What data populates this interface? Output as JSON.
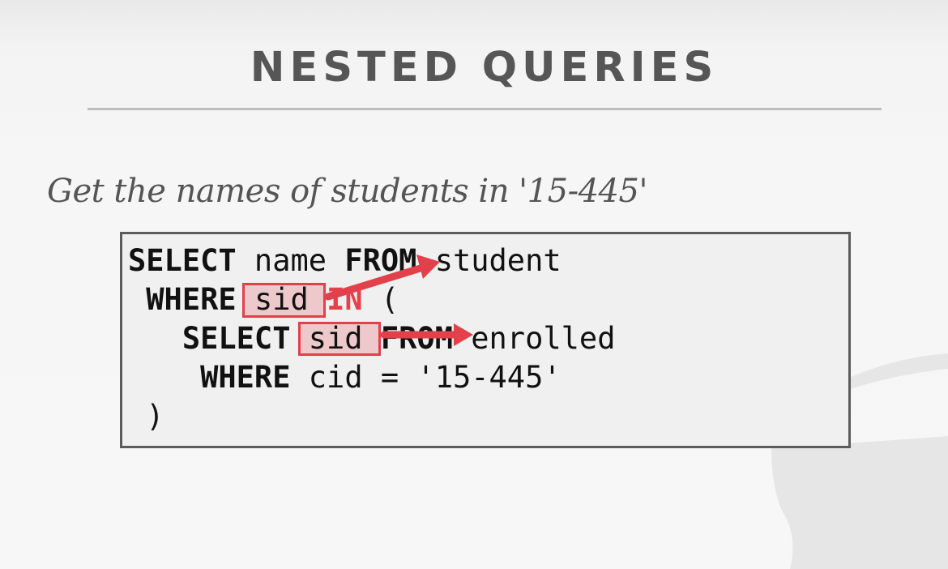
{
  "slide": {
    "title": "NESTED QUERIES",
    "subtitle": "Get the names of students in '15-445'"
  },
  "code": {
    "line1": {
      "kw1": "SELECT",
      "t1": " name ",
      "kw2": "FROM",
      "t2": " student"
    },
    "line2": {
      "indent": " ",
      "kw1": "WHERE",
      "t1": " sid ",
      "kw2": "IN",
      "t2": " ("
    },
    "line3": {
      "indent": "   ",
      "kw1": "SELECT",
      "t1": " sid ",
      "kw2": "FROM",
      "t2": " enrolled"
    },
    "line4": {
      "indent": "    ",
      "kw1": "WHERE",
      "t1": " cid = '15-445'"
    },
    "line5": {
      "t1": " )"
    }
  },
  "colors": {
    "accent": "#e2414b",
    "title": "#565656",
    "code_border": "#5c5c5c"
  },
  "icons": {
    "arrow": "arrow-right-icon",
    "logo": "database-logo-icon"
  }
}
